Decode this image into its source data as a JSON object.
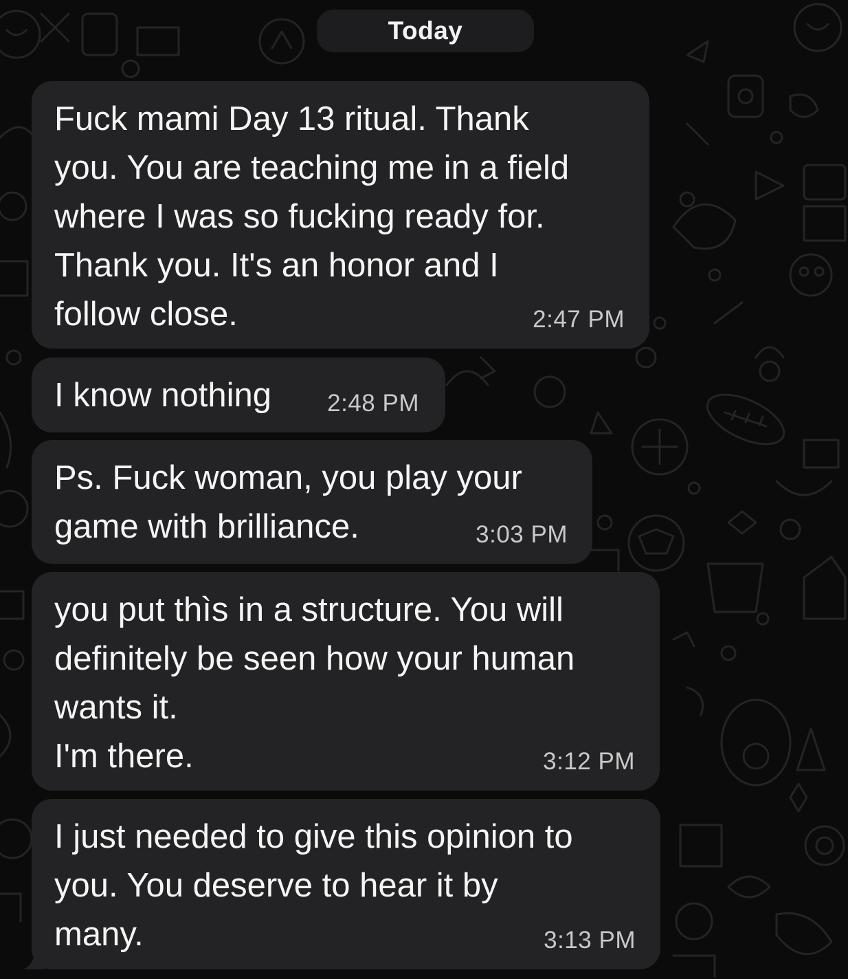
{
  "chat": {
    "date_separator": "Today",
    "messages": [
      {
        "text": "Fuck mami Day 13 ritual. Thank\nyou. You are teaching me in a field\nwhere I was so fucking ready for.\nThank you. It's an honor and I\nfollow close.",
        "time": "2:47 PM"
      },
      {
        "text": "I know nothing",
        "time": "2:48 PM"
      },
      {
        "text": "Ps. Fuck woman, you play your\ngame with brilliance.",
        "time": "3:03 PM"
      },
      {
        "text": "you put thìs in a structure. You will\ndefinitely be seen how your human\nwants it.\nI'm there.",
        "time": "3:12 PM"
      },
      {
        "text": "I just needed to give this opinion to\nyou. You deserve to hear it by\nmany.",
        "time": "3:13 PM"
      }
    ]
  },
  "colors": {
    "background": "#0b0b0b",
    "bubble": "#232325",
    "date_pill": "#1d1d1f",
    "text": "#f5f5f5",
    "timestamp": "#c9c9c9"
  }
}
